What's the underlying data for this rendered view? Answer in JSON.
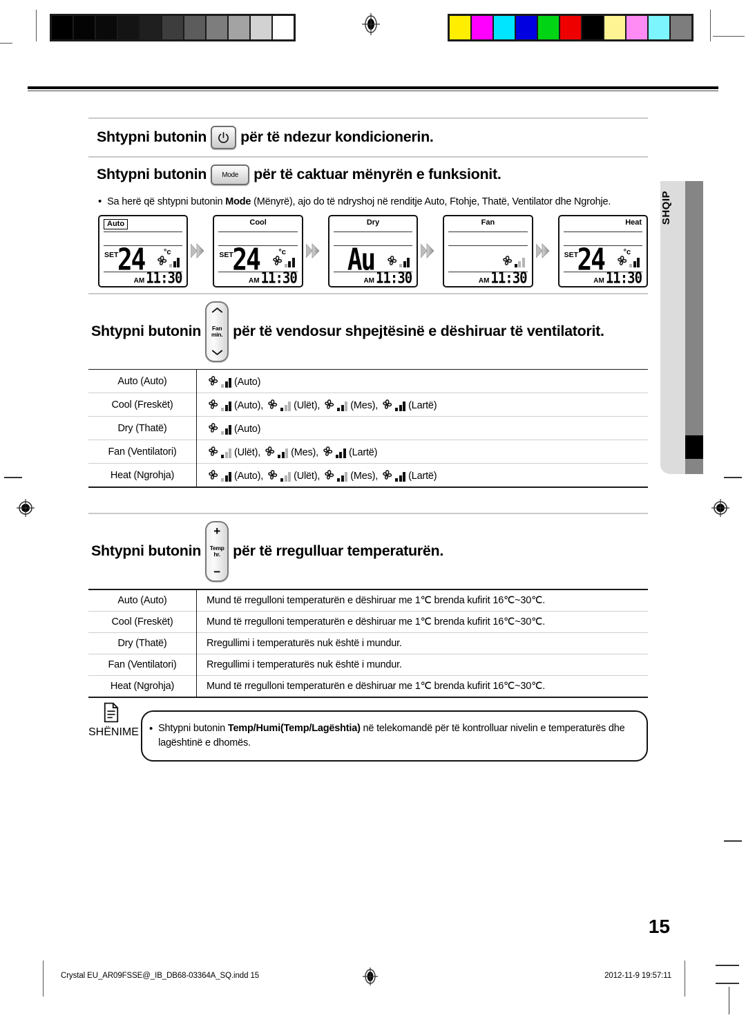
{
  "document": {
    "language_tab": "SHQIP",
    "page_number": "15",
    "footer_left": "Crystal  EU_AR09FSSE@_IB_DB68-03364A_SQ.indd   15",
    "footer_right": "2012-11-9   19:57:11"
  },
  "calibration": {
    "grayscale": [
      "#000000",
      "#040404",
      "#0a0a0a",
      "#141414",
      "#1f1f1f",
      "#3d3d3d",
      "#5c5c5c",
      "#7d7d7d",
      "#a3a3a3",
      "#d2d2d2",
      "#ffffff"
    ],
    "colors": [
      "#ffee00",
      "#ff00ff",
      "#00e5ff",
      "#0000e0",
      "#00d415",
      "#ee0000",
      "#000000",
      "#fff493",
      "#ff8cf5",
      "#7df5ff",
      "#7d7d7d"
    ]
  },
  "sections": {
    "power": {
      "prefix": "Shtypni butonin",
      "button_icon": "power-icon",
      "suffix": "për të ndezur kondicionerin."
    },
    "mode": {
      "prefix": "Shtypni butonin",
      "button_label": "Mode",
      "suffix": "për të caktuar mënyrën e funksionit.",
      "bullet": "Sa herë që shtypni butonin ",
      "bullet_bold": "Mode",
      "bullet_rest": " (Mënyrë), ajo do të ndryshoj në renditje Auto, Ftohje, Thatë, Ventilator dhe Ngrohje."
    },
    "fan": {
      "prefix": "Shtypni butonin",
      "button_top": "chevron-up-icon",
      "button_mid_line1": "Fan",
      "button_mid_line2": "min.",
      "button_bottom": "chevron-down-icon",
      "suffix": "për të vendosur shpejtësinë e dëshiruar të ventilatorit."
    },
    "temp": {
      "prefix": "Shtypni butonin",
      "button_plus": "+",
      "button_mid_line1": "Temp",
      "button_mid_line2": "hr.",
      "button_minus": "−",
      "suffix": "për të rregulluar temperaturën."
    }
  },
  "lcd_sequence": [
    {
      "mode_label": "Auto",
      "label_align": "left",
      "boxed": true,
      "set": "SET",
      "temp": "24",
      "degree": "°c",
      "fan": {
        "visible": true,
        "bars": [
          "off",
          "on",
          "on"
        ]
      },
      "am": "AM",
      "time": "11:30"
    },
    {
      "mode_label": "Cool",
      "label_align": "center",
      "boxed": false,
      "set": "SET",
      "temp": "24",
      "degree": "°c",
      "fan": {
        "visible": true,
        "bars": [
          "off",
          "on",
          "on"
        ]
      },
      "am": "AM",
      "time": "11:30"
    },
    {
      "mode_label": "Dry",
      "label_align": "center",
      "boxed": false,
      "set": "",
      "temp": "Au",
      "degree": "",
      "fan": {
        "visible": true,
        "bars": [
          "off",
          "on",
          "on"
        ]
      },
      "am": "AM",
      "time": "11:30"
    },
    {
      "mode_label": "Fan",
      "label_align": "center",
      "boxed": false,
      "set": "",
      "temp": "",
      "degree": "",
      "fan": {
        "visible": true,
        "bars": [
          "on",
          "off",
          "off"
        ]
      },
      "am": "AM",
      "time": "11:30"
    },
    {
      "mode_label": "Heat",
      "label_align": "right",
      "boxed": false,
      "set": "SET",
      "temp": "24",
      "degree": "°c",
      "fan": {
        "visible": true,
        "bars": [
          "off",
          "on",
          "on"
        ]
      },
      "am": "AM",
      "time": "11:30"
    }
  ],
  "fan_table": [
    {
      "mode": "Auto (Auto)",
      "speeds": [
        {
          "bars": [
            "off",
            "on",
            "on"
          ],
          "label": "(Auto)"
        }
      ]
    },
    {
      "mode": "Cool (Freskët)",
      "speeds": [
        {
          "bars": [
            "off",
            "on",
            "on"
          ],
          "label": "(Auto),"
        },
        {
          "bars": [
            "on",
            "off",
            "off"
          ],
          "label": "(Ulët),"
        },
        {
          "bars": [
            "on",
            "on",
            "off"
          ],
          "label": "(Mes),"
        },
        {
          "bars": [
            "on",
            "on",
            "on"
          ],
          "label": "(Lartë)"
        }
      ]
    },
    {
      "mode": "Dry (Thatë)",
      "speeds": [
        {
          "bars": [
            "off",
            "on",
            "on"
          ],
          "label": "(Auto)"
        }
      ]
    },
    {
      "mode": "Fan (Ventilatori)",
      "speeds": [
        {
          "bars": [
            "on",
            "off",
            "off"
          ],
          "label": "(Ulët),"
        },
        {
          "bars": [
            "on",
            "on",
            "off"
          ],
          "label": "(Mes),"
        },
        {
          "bars": [
            "on",
            "on",
            "on"
          ],
          "label": "(Lartë)"
        }
      ]
    },
    {
      "mode": "Heat (Ngrohja)",
      "speeds": [
        {
          "bars": [
            "off",
            "on",
            "on"
          ],
          "label": "(Auto),"
        },
        {
          "bars": [
            "on",
            "off",
            "off"
          ],
          "label": "(Ulët),"
        },
        {
          "bars": [
            "on",
            "on",
            "off"
          ],
          "label": "(Mes),"
        },
        {
          "bars": [
            "on",
            "on",
            "on"
          ],
          "label": "(Lartë)"
        }
      ]
    }
  ],
  "temp_table": [
    {
      "mode": "Auto (Auto)",
      "text": "Mund të rregulloni temperaturën e dëshiruar me 1℃ brenda kufirit 16℃~30℃."
    },
    {
      "mode": "Cool (Freskët)",
      "text": "Mund të rregulloni temperaturën e dëshiruar me 1℃ brenda kufirit 16℃~30℃."
    },
    {
      "mode": "Dry (Thatë)",
      "text": "Rregullimi i temperaturës nuk është i mundur."
    },
    {
      "mode": "Fan (Ventilatori)",
      "text": "Rregullimi i temperaturës nuk është i mundur."
    },
    {
      "mode": "Heat (Ngrohja)",
      "text": "Mund të rregulloni temperaturën e dëshiruar me 1℃ brenda kufirit 16℃~30℃."
    }
  ],
  "note": {
    "icon_label": "SHËNIME",
    "bullet": "•",
    "text_1": "Shtypni butonin ",
    "text_bold": "Temp/Humi",
    "text_bold2": "(Temp/Lagështia)",
    "text_2": " në telekomandë për të kontrolluar nivelin e temperaturës dhe lagështinë e dhomës."
  }
}
